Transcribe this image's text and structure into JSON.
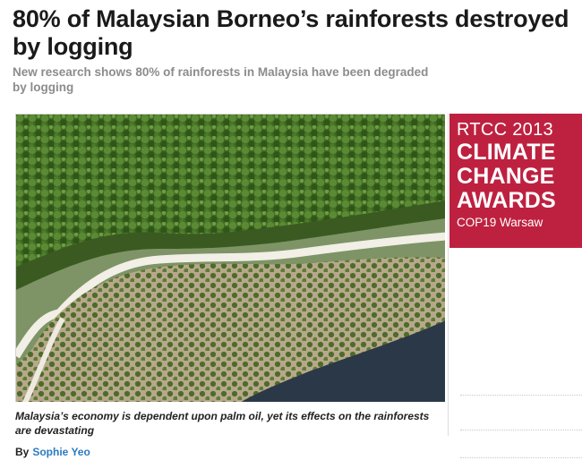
{
  "article": {
    "headline": "80% of Malaysian Borneo’s rainforests destroyed by logging",
    "standfirst": "New research shows 80% of rainforests in Malaysia have been degraded by logging",
    "photo_icon": "aerial-photo-rainforest-palm-plantation",
    "caption": "Malaysia’s economy is dependent upon palm oil, yet its effects on the rainforests are devastating",
    "byline_prefix": "By",
    "author": "Sophie Yeo"
  },
  "sidebar": {
    "ad": {
      "line1": "RTCC 2013",
      "line2": "CLIMATE",
      "line3": "CHANGE",
      "line4": "AWARDS",
      "line5": "COP19 Warsaw",
      "background": "#be2140"
    }
  },
  "colors": {
    "link": "#2a7cc0",
    "standfirst": "#8c8c8c"
  }
}
